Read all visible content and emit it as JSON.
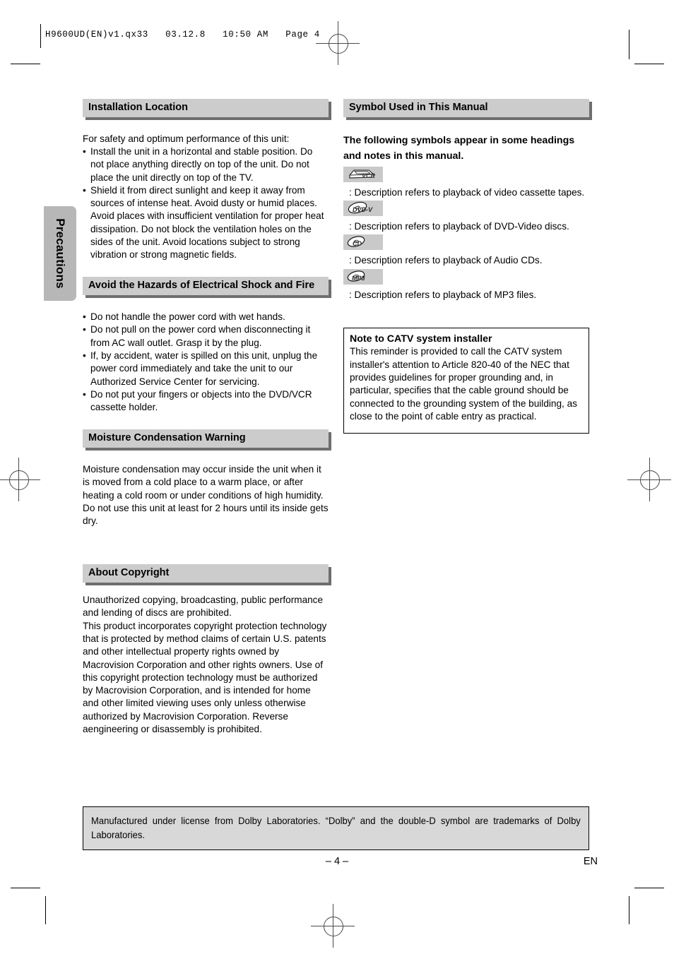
{
  "print_header": {
    "text": "H9600UD(EN)v1.qx33   03.12.8   10:50 AM   Page 4"
  },
  "side_tab": {
    "label": "Precautions"
  },
  "left_column": {
    "sections": [
      {
        "heading": "Installation Location",
        "intro": "For safety and optimum performance of this unit:",
        "bullets": [
          "Install the unit in a horizontal and stable position. Do not place anything directly on top of the unit. Do not place the unit directly on top of the TV.",
          "Shield it from direct sunlight and keep it away from sources of intense heat. Avoid dusty or humid places. Avoid places with insufficient ventilation for proper heat dissipation. Do not block the ventilation holes on the sides of the unit. Avoid locations subject to strong vibration or strong magnetic fields."
        ]
      },
      {
        "heading": "Avoid the Hazards of Electrical Shock and Fire",
        "bullets": [
          "Do not handle the power cord with wet hands.",
          "Do not pull on the power cord when disconnecting it from AC wall outlet. Grasp it by the plug.",
          "If, by accident, water is spilled on this unit, unplug the power cord immediately and take the unit to our Authorized Service Center for servicing.",
          "Do not put your fingers or objects into the DVD/VCR cassette holder."
        ]
      },
      {
        "heading": "Moisture Condensation Warning",
        "paragraph": "Moisture condensation may occur inside the unit when it is moved from a cold place to a warm place, or after heating a cold room or under conditions of high humidity. Do not use this unit at least for 2 hours until its inside gets dry."
      },
      {
        "heading": "About Copyright",
        "paragraph_1": "Unauthorized copying, broadcasting, public performance and lending of discs are prohibited.",
        "paragraph_2": "This product incorporates copyright protection technology that is protected by method claims of certain U.S. patents and other intellectual property rights owned by Macrovision Corporation and other rights owners. Use of this copyright protection technology must be authorized by Macrovision Corporation, and is intended for home and other limited viewing uses only unless otherwise authorized by Macrovision Corporation. Reverse aengineering or disassembly is prohibited."
      }
    ]
  },
  "right_column": {
    "heading": "Symbol Used in This Manual",
    "intro": "The following symbols appear in some headings and notes in this manual.",
    "symbols": [
      {
        "icon": "vcr-symbol-icon",
        "icon_label": "VCR",
        "description": ": Description refers to playback of video cassette tapes."
      },
      {
        "icon": "dvd-video-symbol-icon",
        "icon_label": "DVD-V",
        "description": ": Description refers to playback of DVD-Video discs."
      },
      {
        "icon": "cd-symbol-icon",
        "icon_label": "CD",
        "description": ": Description refers to playback of Audio CDs."
      },
      {
        "icon": "mp3-symbol-icon",
        "icon_label": "MP3",
        "description": ": Description refers to playback of  MP3 files."
      }
    ],
    "note_box": {
      "title": "Note to CATV system installer",
      "body": "This reminder is provided to call the CATV system installer's attention to Article 820-40 of the NEC that provides guidelines for proper grounding and, in particular, specifies that the cable ground should be connected to the grounding system of the building, as close to the point of cable entry as practical."
    }
  },
  "dolby_notice": {
    "text": "Manufactured under license from Dolby Laboratories. “Dolby” and the double-D symbol are trademarks of Dolby Laboratories."
  },
  "footer": {
    "page_number": "– 4 –",
    "language_code": "EN"
  },
  "colors": {
    "header_bar": "#cccccc",
    "header_shadow": "#6e6e6e",
    "tab_background": "#b7b7b7",
    "icon_badge": "#c9c9c9",
    "dolby_background": "#d8d8d8"
  }
}
